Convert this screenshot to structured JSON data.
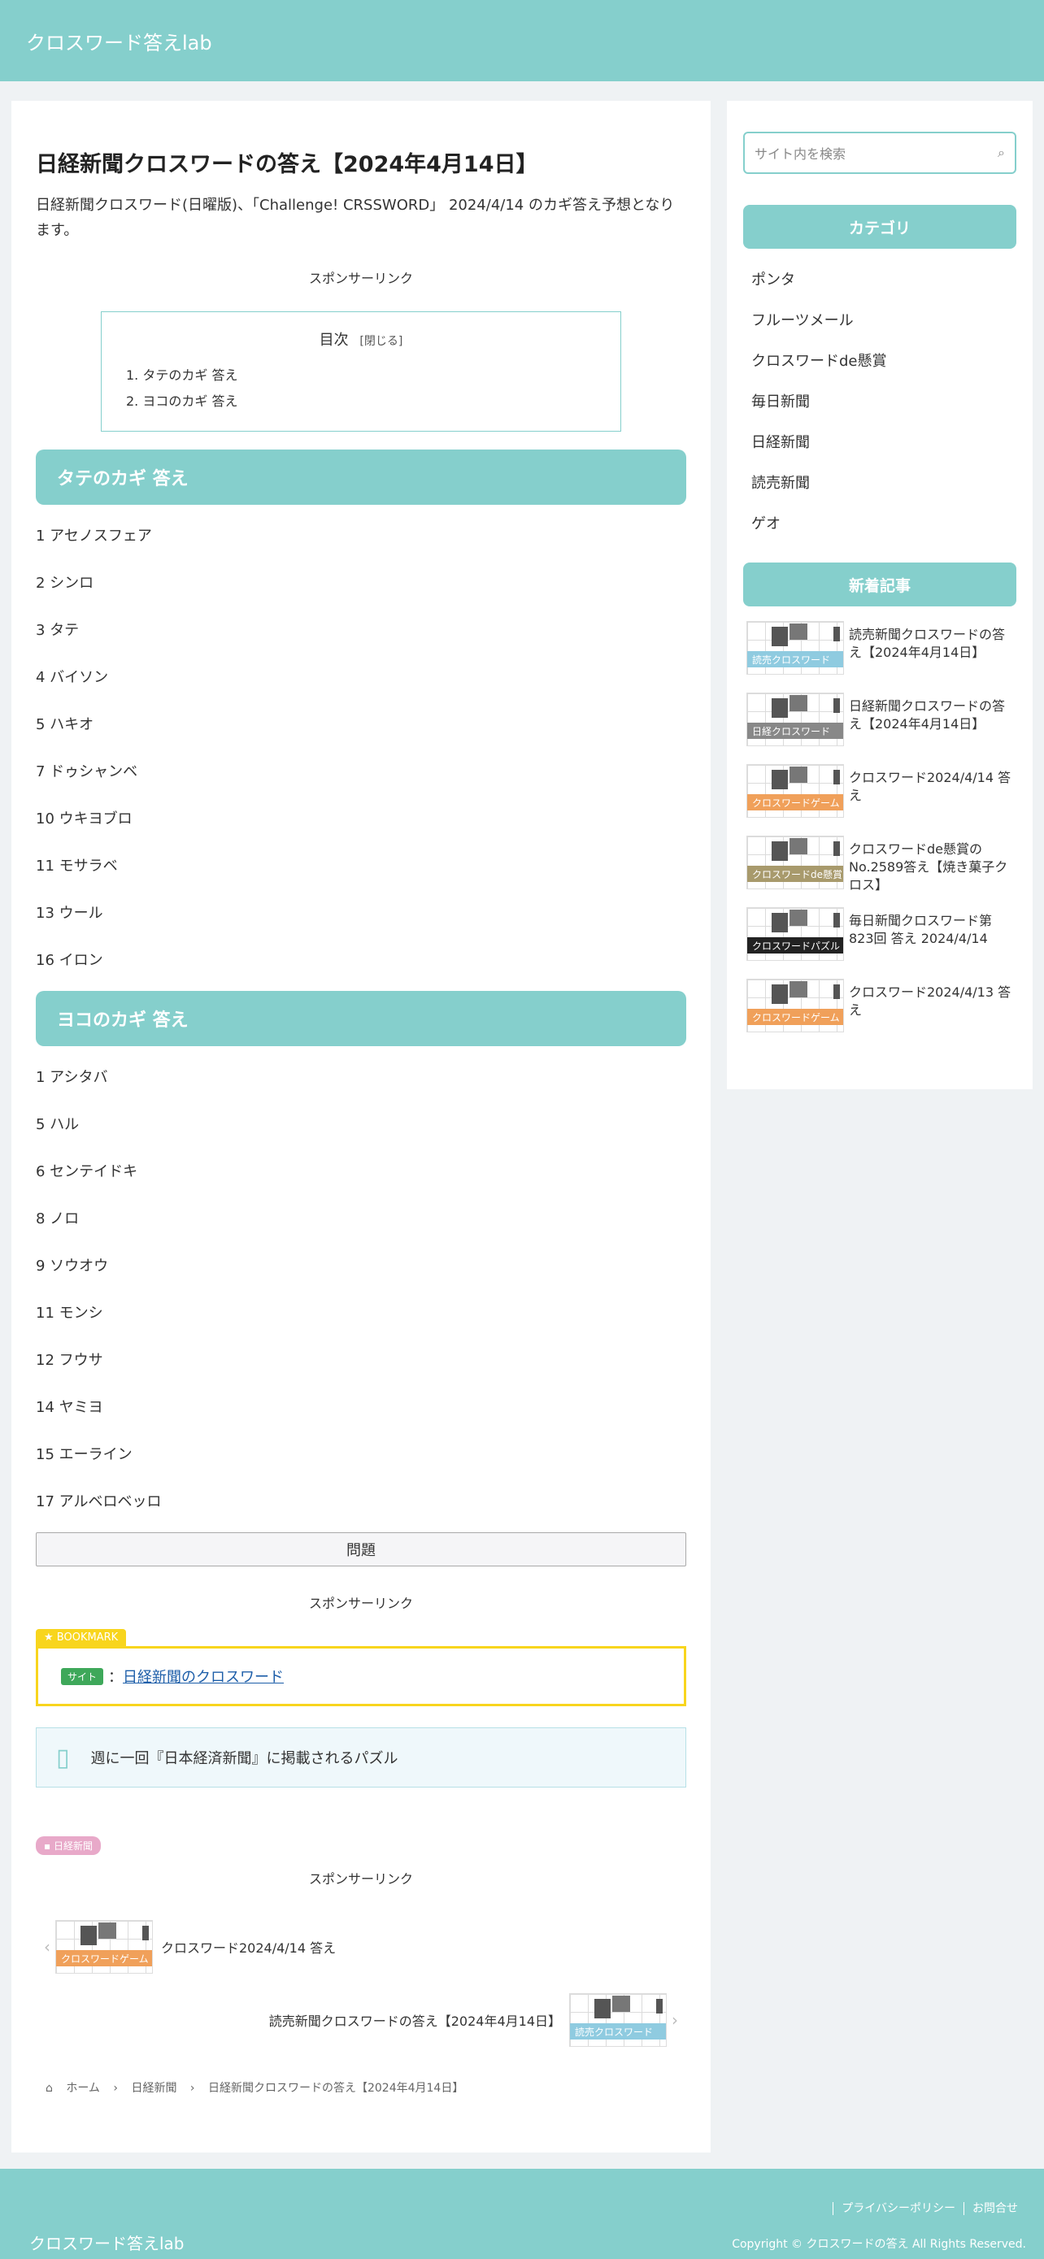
{
  "site": {
    "title": "クロスワード答えlab"
  },
  "article": {
    "title": "日経新聞クロスワードの答え【2024年4月14日】",
    "lead": "日経新聞クロスワード(日曜版)、「Challenge! CRSSWORD」 2024/4/14 のカギ答え予想となります。",
    "sponsor": "スポンサーリンク",
    "toc": {
      "title": "目次",
      "toggle": "[閉じる]",
      "items": [
        "1. タテのカギ 答え",
        "2. ヨコのカギ 答え"
      ]
    },
    "tate": {
      "heading": "タテのカギ 答え",
      "items": [
        "1 アセノスフェア",
        "2 シンロ",
        "3 タテ",
        "4 バイソン",
        "5 ハキオ",
        "7 ドゥシャンベ",
        "10 ウキヨブロ",
        "11 モサラベ",
        "13 ウール",
        "16 イロン"
      ]
    },
    "yoko": {
      "heading": "ヨコのカギ 答え",
      "items": [
        "1 アシタバ",
        "5 ハル",
        "6 センテイドキ",
        "8 ノロ",
        "9 ソウオウ",
        "11 モンシ",
        "12 フウサ",
        "14 ヤミヨ",
        "15 エーライン",
        "17 アルベロベッロ"
      ]
    },
    "question_button": "問題",
    "bookmark": {
      "tag": "BOOKMARK",
      "badge": "サイト",
      "colon": "：",
      "link": "日経新聞のクロスワード"
    },
    "info": "週に一回『日本経済新聞』に掲載されるパズル",
    "category_tag": "日経新聞",
    "prev_post": {
      "title": "クロスワード2024/4/14 答え",
      "label": "クロスワードゲーム",
      "color": "#f0a05a"
    },
    "next_post": {
      "title": "読売新聞クロスワードの答え【2024年4月14日】",
      "label": "読売クロスワード",
      "color": "#8fcbe0"
    },
    "breadcrumb": [
      "ホーム",
      "日経新聞",
      "日経新聞クロスワードの答え【2024年4月14日】"
    ]
  },
  "sidebar": {
    "search_placeholder": "サイト内を検索",
    "category_title": "カテゴリ",
    "categories": [
      "ポンタ",
      "フルーツメール",
      "クロスワードde懸賞",
      "毎日新聞",
      "日経新聞",
      "読売新聞",
      "ゲオ"
    ],
    "recent_title": "新着記事",
    "recent": [
      {
        "title": "読売新聞クロスワードの答え【2024年4月14日】",
        "label": "読売クロスワード",
        "color": "#8fcbe0"
      },
      {
        "title": "日経新聞クロスワードの答え【2024年4月14日】",
        "label": "日経クロスワード",
        "color": "#888888"
      },
      {
        "title": "クロスワード2024/4/14 答え",
        "label": "クロスワードゲーム",
        "color": "#f0a05a"
      },
      {
        "title": "クロスワードde懸賞の No.2589答え【焼き菓子クロス】",
        "label": "クロスワードde懸賞",
        "color": "#a89a6c"
      },
      {
        "title": "毎日新聞クロスワード第823回 答え 2024/4/14",
        "label": "クロスワードパズル",
        "color": "#222222"
      },
      {
        "title": "クロスワード2024/4/13 答え",
        "label": "クロスワードゲーム",
        "color": "#f0a05a"
      }
    ]
  },
  "footer": {
    "links": [
      "プライバシーポリシー",
      "お問合せ"
    ],
    "copyright": "Copyright © クロスワードの答え All Rights Reserved.",
    "title": "クロスワード答えlab"
  }
}
